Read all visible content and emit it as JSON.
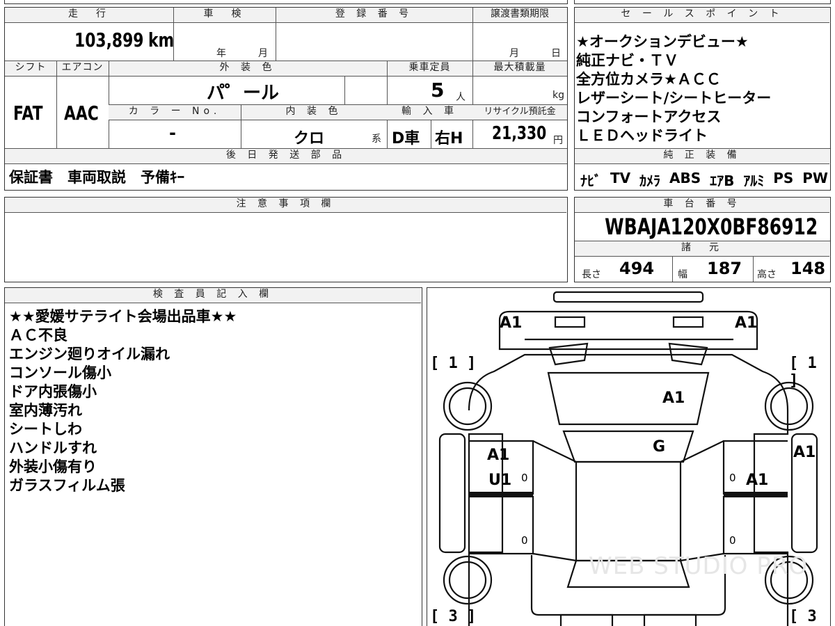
{
  "vehicle": {
    "mileage_header": "走　行",
    "mileage": "103,899",
    "mileage_unit": "km",
    "inspection_header": "車　検",
    "inspection_year_label": "年",
    "inspection_month_label": "月",
    "registration_header": "登 録 番 号",
    "transfer_header": "譲渡書類期限",
    "transfer_month_label": "月",
    "transfer_day_label": "日",
    "shift_header": "シフト",
    "shift": "FAT",
    "ac_header": "エアコン",
    "ac": "AAC",
    "exterior_color_header": "外 装 色",
    "exterior_color": "パ゜ール",
    "capacity_header": "乗車定員",
    "capacity": "5",
    "capacity_unit": "人",
    "max_load_header": "最大積載量",
    "max_load_unit": "kg",
    "color_no_header": "カ ラ ー No.",
    "color_no": "-",
    "interior_color_header": "内 装 色",
    "interior_color": "クロ",
    "interior_color_suffix": "系",
    "import_header": "輸 入 車",
    "import_type": "D車",
    "steering": "右H",
    "recycle_header": "リサイクル預託金",
    "recycle_fee": "21,330",
    "recycle_unit": "円"
  },
  "sales_points": {
    "header": "セ ー ル ス ポ イ ン ト",
    "items": [
      "★オークションデビュー★",
      "純正ナビ・ＴＶ",
      "全方位カメラ★ＡＣＣ",
      "レザーシート/シートヒーター",
      "コンフォートアクセス",
      "ＬＥＤヘッドライト"
    ]
  },
  "later_parts": {
    "header": "後 日 発 送 部 品",
    "value": "保証書　車両取説　予備ｷｰ"
  },
  "equipment": {
    "header": "純 正 装 備",
    "items": [
      "ﾅﾋﾞ",
      "TV",
      "ｶﾒﾗ",
      "ABS",
      "ｴｱB",
      "ｱﾙﾐ",
      "PS",
      "PW"
    ]
  },
  "notes": {
    "header": "注 意 事 項 欄"
  },
  "chassis": {
    "header": "車 台 番 号",
    "number": "WBAJA120X0BF86912"
  },
  "specs": {
    "header": "諸　元",
    "length_label": "長さ",
    "length": "494",
    "width_label": "幅",
    "width": "187",
    "height_label": "高さ",
    "height": "148"
  },
  "inspector": {
    "header": "検 査 員 記 入 欄",
    "lines": [
      "★★愛媛サテライト会場出品車★★",
      "ＡＣ不良",
      "エンジン廻りオイル漏れ",
      "コンソール傷小",
      "ドア内張傷小",
      "室内薄汚れ",
      "シートしわ",
      "ハンドルすれ",
      "外装小傷有り",
      "ガラスフィルム張"
    ]
  },
  "diagram": {
    "bracket_tl": "[ 1 ]",
    "bracket_tr": "[ 1 ]",
    "bracket_bl": "[ 3 ]",
    "bracket_br": "[ 3 ]",
    "mark_front_left": "A1",
    "mark_front_right": "A1",
    "mark_hood": "A1",
    "mark_windshield": "G",
    "mark_fender_right": "A1",
    "mark_door_fl_1": "A1",
    "mark_door_fl_2": "U1",
    "mark_door_fr": "A1",
    "tiny_fl": "0",
    "tiny_fr": "0",
    "tiny_rl": "0",
    "tiny_rr": "0",
    "watermark": "WEB STUDIO PRO"
  }
}
